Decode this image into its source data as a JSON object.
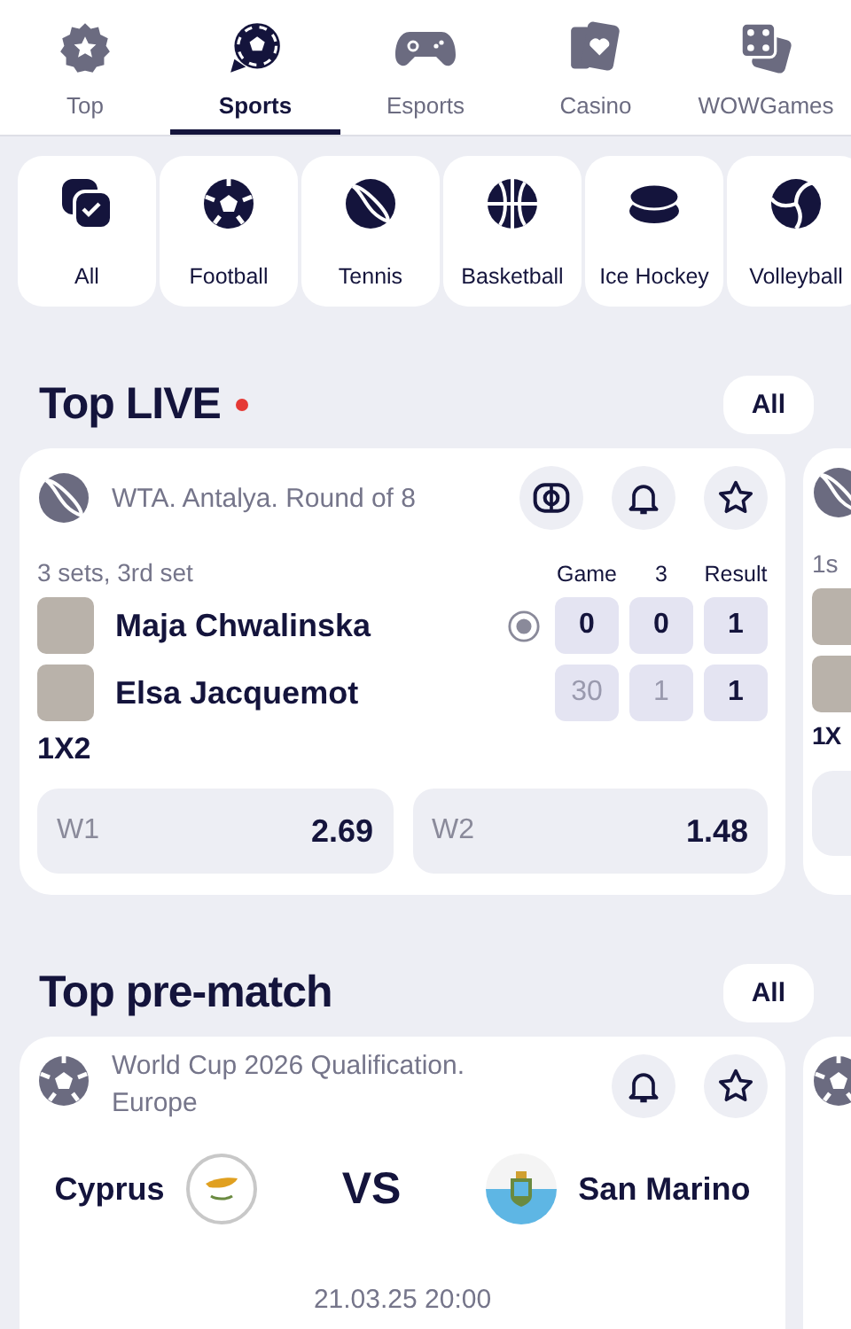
{
  "nav_tabs": [
    {
      "label": "Top",
      "kind": "badge",
      "selected": false
    },
    {
      "label": "Sports",
      "kind": "ball",
      "selected": true
    },
    {
      "label": "Esports",
      "kind": "gamepad",
      "selected": false
    },
    {
      "label": "Casino",
      "kind": "cards",
      "selected": false
    },
    {
      "label": "WOWGames",
      "kind": "dice",
      "selected": false
    }
  ],
  "sport_chips": [
    {
      "label": "All",
      "kind": "all"
    },
    {
      "label": "Football",
      "kind": "football"
    },
    {
      "label": "Tennis",
      "kind": "tennis"
    },
    {
      "label": "Basketball",
      "kind": "basketball"
    },
    {
      "label": "Ice Hockey",
      "kind": "hockey"
    },
    {
      "label": "Volleyball",
      "kind": "volleyball"
    }
  ],
  "top_live": {
    "title": "Top LIVE",
    "all_button": "All",
    "match": {
      "league": "WTA. Antalya. Round of 8",
      "status": "3 sets, 3rd set",
      "columns": [
        "Game",
        "3",
        "Result"
      ],
      "players": [
        {
          "name": "Maja Chwalinska",
          "serving": true,
          "scores": [
            {
              "value": "0",
              "dimmed": false
            },
            {
              "value": "0",
              "dimmed": false
            },
            {
              "value": "1",
              "dimmed": false
            }
          ]
        },
        {
          "name": "Elsa Jacquemot",
          "serving": false,
          "scores": [
            {
              "value": "30",
              "dimmed": true
            },
            {
              "value": "1",
              "dimmed": true
            },
            {
              "value": "1",
              "dimmed": false
            }
          ]
        }
      ],
      "market": "1X2",
      "odds": [
        {
          "label": "W1",
          "value": "2.69"
        },
        {
          "label": "W2",
          "value": "1.48"
        }
      ]
    },
    "next_match": {
      "status": "1s",
      "market": "1X"
    }
  },
  "top_prematch": {
    "title": "Top pre-match",
    "all_button": "All",
    "match": {
      "league": "World Cup 2026 Qualification. Europe",
      "home": "Cyprus",
      "separator": "VS",
      "away": "San Marino",
      "datetime": "21.03.25 20:00"
    }
  }
}
